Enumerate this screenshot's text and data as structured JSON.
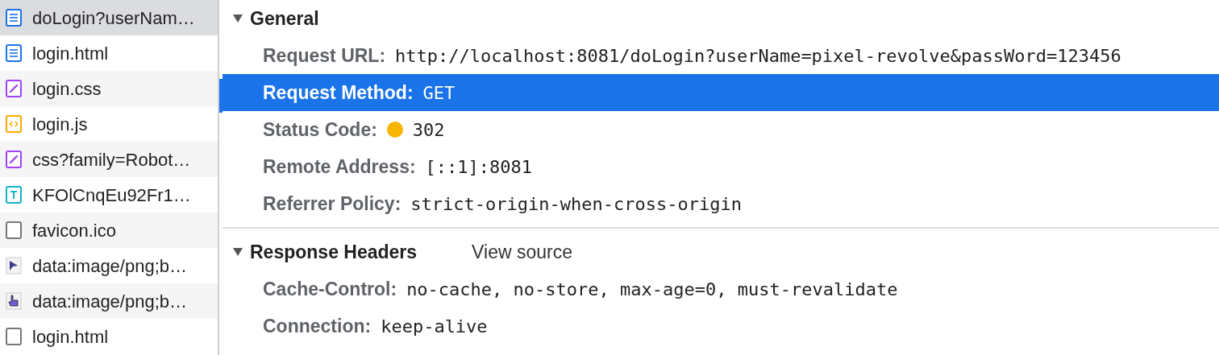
{
  "file_list": [
    {
      "name": "doLogin?userNam…",
      "kind": "doc",
      "selected": true
    },
    {
      "name": "login.html",
      "kind": "doc",
      "selected": false
    },
    {
      "name": "login.css",
      "kind": "css",
      "selected": false
    },
    {
      "name": "login.js",
      "kind": "js",
      "selected": false
    },
    {
      "name": "css?family=Robot…",
      "kind": "css",
      "selected": false
    },
    {
      "name": "KFOlCnqEu92Fr1…",
      "kind": "font",
      "selected": false
    },
    {
      "name": "favicon.ico",
      "kind": "blank",
      "selected": false
    },
    {
      "name": "data:image/png;b…",
      "kind": "cursor",
      "selected": false
    },
    {
      "name": "data:image/png;b…",
      "kind": "hand",
      "selected": false
    },
    {
      "name": "login.html",
      "kind": "blank",
      "selected": false
    }
  ],
  "sections": [
    {
      "title": "General",
      "expanded": true,
      "rows": [
        {
          "label": "Request URL:",
          "value": "http://localhost:8081/doLogin?userName=pixel-revolve&passWord=123456",
          "selected": false
        },
        {
          "label": "Request Method:",
          "value": "GET",
          "selected": true
        },
        {
          "label": "Status Code:",
          "value": "302",
          "color": "#f7b500",
          "selected": false
        },
        {
          "label": "Remote Address:",
          "value": "[::1]:8081",
          "selected": false
        },
        {
          "label": "Referrer Policy:",
          "value": "strict-origin-when-cross-origin",
          "selected": false
        }
      ]
    },
    {
      "title": "Response Headers",
      "expanded": true,
      "link": "View source",
      "rows": [
        {
          "label": "Cache-Control:",
          "value": "no-cache, no-store, max-age=0, must-revalidate",
          "selected": false
        },
        {
          "label": "Connection:",
          "value": "keep-alive",
          "selected": false
        }
      ]
    }
  ]
}
